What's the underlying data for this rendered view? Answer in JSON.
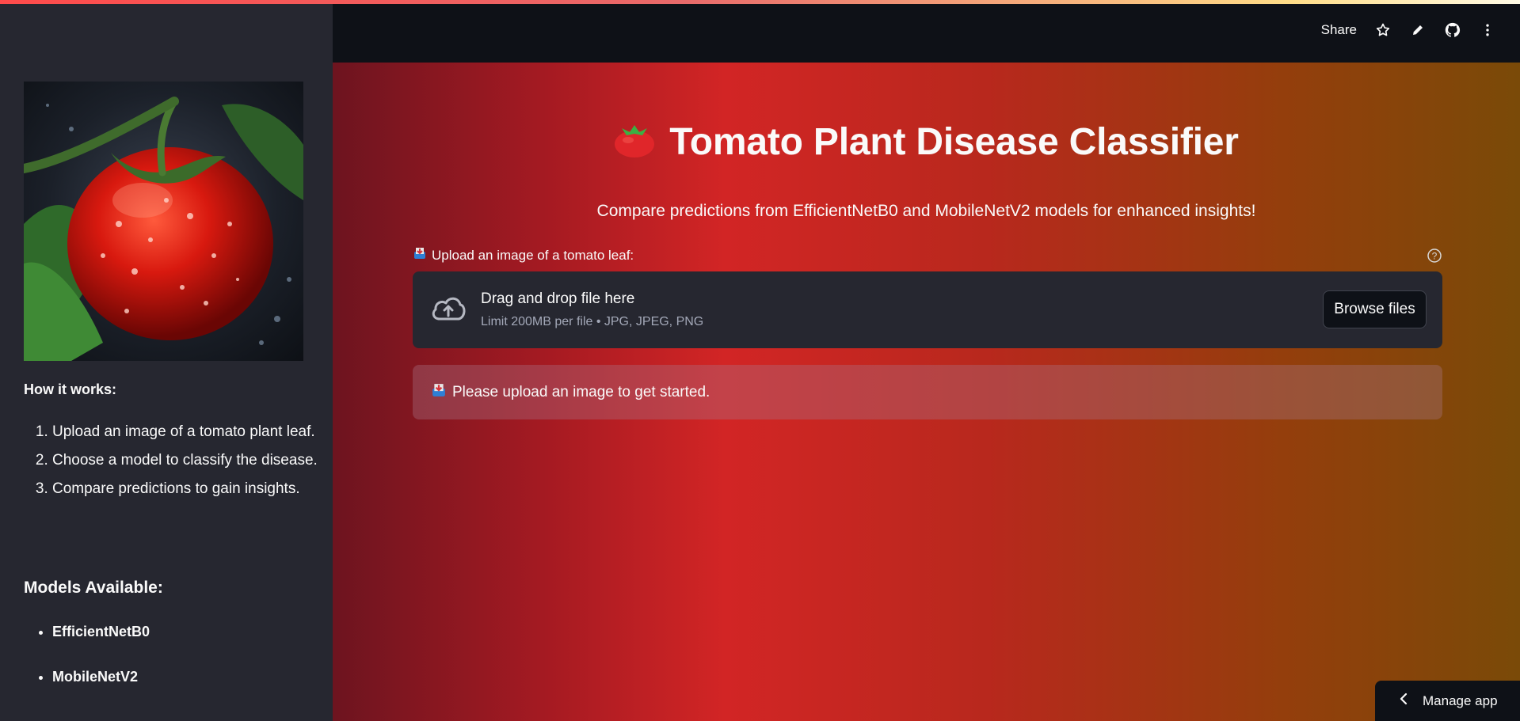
{
  "header": {
    "share_label": "Share",
    "icons": [
      "star-icon",
      "pencil-icon",
      "github-icon",
      "more-vertical-icon"
    ]
  },
  "sidebar": {
    "how_it_works_title": "How it works:",
    "steps": [
      "Upload an image of a tomato plant leaf.",
      "Choose a model to classify the disease.",
      "Compare predictions to gain insights."
    ],
    "models_title": "Models Available:",
    "models": [
      "EfficientNetB0",
      "MobileNetV2"
    ]
  },
  "main": {
    "title": "Tomato Plant Disease Classifier",
    "subtitle": "Compare predictions from EfficientNetB0 and MobileNetV2 models for enhanced insights!",
    "upload_label": "Upload an image of a tomato leaf:",
    "dropzone": {
      "title": "Drag and drop file here",
      "limit": "Limit 200MB per file • JPG, JPEG, PNG",
      "browse_label": "Browse files"
    },
    "info_message": "Please upload an image to get started."
  },
  "footer": {
    "manage_label": "Manage app"
  },
  "colors": {
    "sidebar_bg": "#262730",
    "header_bg": "#0e1117",
    "gradient_start": "#6d141f",
    "gradient_mid": "#d22525",
    "gradient_end": "#7a4a08",
    "dropzone_bg": "#262730"
  }
}
